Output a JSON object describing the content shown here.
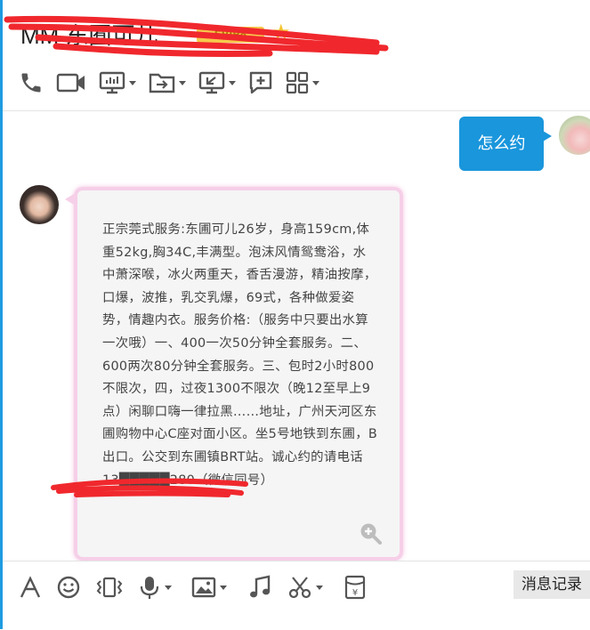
{
  "header": {
    "title": "MM 东囿可儿",
    "badge": "SVIP8"
  },
  "toolbar": {
    "icons": [
      "phone-icon",
      "video-call-icon",
      "screen-share-icon",
      "file-transfer-icon",
      "remote-desktop-icon",
      "add-comment-icon",
      "apps-icon"
    ]
  },
  "messages": [
    {
      "side": "right",
      "text": "怎么约"
    },
    {
      "side": "left",
      "text": "正宗莞式服务:东圃可儿26岁，身高159cm,体重52kg,胸34C,丰满型。泡沫风情鸳鸯浴，水中萧深喉，冰火两重天，香舌漫游，精油按摩，口爆，波推，乳交乳爆，69式，各种做爱姿势，情趣内衣。服务价格:（服务中只要出水算一次哦）一、400一次50分钟全套服务。二、600两次80分钟全套服务。三、包时2小时800不限次，四，过夜1300不限次（晚12至早上9点）闲聊口嗨一律拉黑……地址，广州天河区东圃购物中心C座对面小区。坐5号地铁到东圃，B出口。公交到东圃镇BRT站。诚心约的请电话13█████280（微信同号）"
    }
  ],
  "input_toolbar": {
    "history_label": "消息记录",
    "icons": [
      "font-icon",
      "emoji-icon",
      "shake-icon",
      "voice-icon",
      "image-icon",
      "music-icon",
      "screenshot-icon",
      "red-packet-icon"
    ]
  }
}
